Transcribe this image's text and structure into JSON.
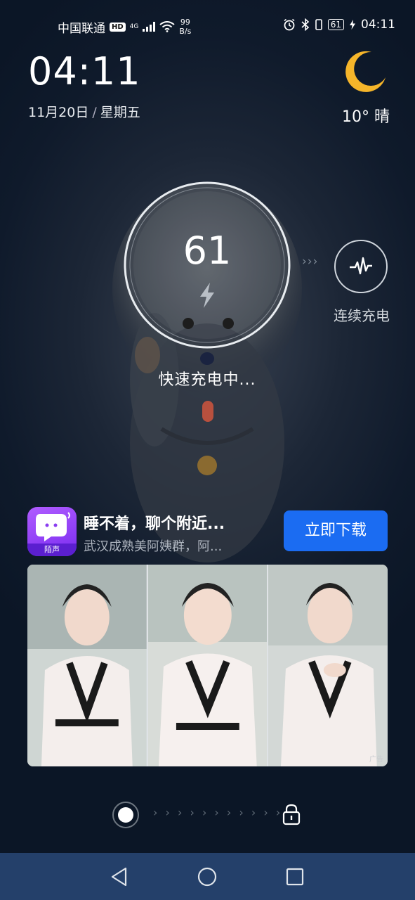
{
  "status_bar": {
    "carrier": "中国联通",
    "hd": "HD",
    "network": "4G",
    "speed_value": "99",
    "speed_unit": "B/s",
    "battery": "61",
    "time": "04:11",
    "icons": [
      "signal-icon",
      "wifi-icon",
      "alarm-icon",
      "bluetooth-icon",
      "battery-icon",
      "charging-icon"
    ]
  },
  "lockscreen": {
    "time": "04:11",
    "date": "11月20日",
    "date_separator": "/",
    "weekday": "星期五",
    "temperature": "10°",
    "weather": "晴",
    "weather_icon": "moon-icon"
  },
  "charging": {
    "percent": "61",
    "status": "快速充电中...",
    "continuous_label": "连续充电",
    "arrows": "›››"
  },
  "ad": {
    "app_tag": "陌声",
    "title": "睡不着，聊个附近...",
    "subtitle": "武汉成熟美阿姨群，阿...",
    "button": "立即下载",
    "ad_label": "广告"
  },
  "unlock": {
    "track": "› › › › › › › › › › ›"
  },
  "colors": {
    "accent": "#1b6cf2",
    "navbar": "#24406a",
    "moon": "#f5b52a"
  }
}
